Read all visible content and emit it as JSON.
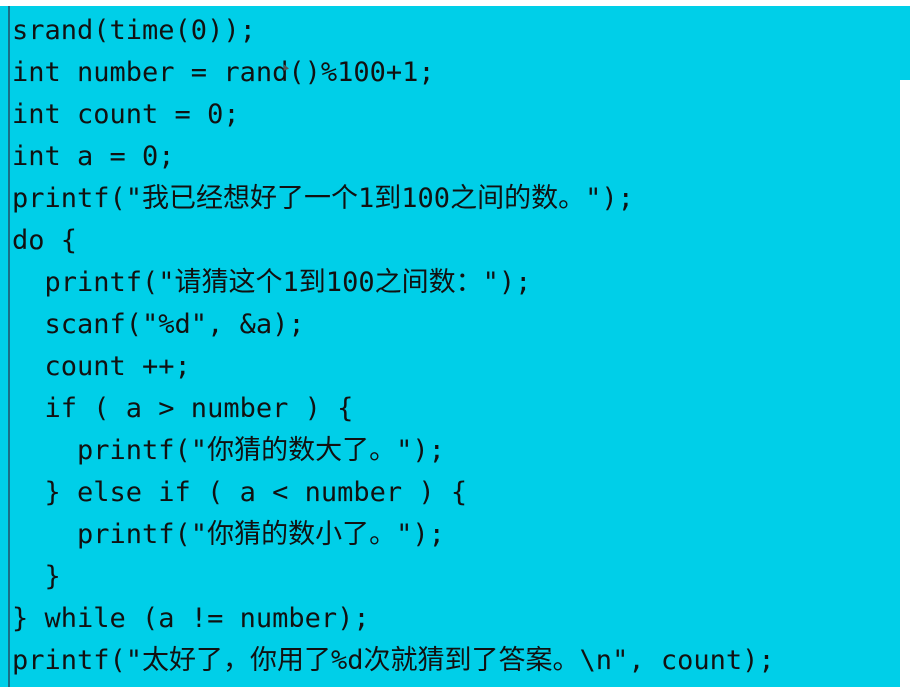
{
  "colors": {
    "panel_background": "#00cfe8",
    "text": "#111111"
  },
  "code": {
    "lines": [
      "srand(time(0));",
      "int number = rand()%100+1;",
      "int count = 0;",
      "int a = 0;",
      "printf(\"我已经想好了一个1到100之间的数。\");",
      "do {",
      "  printf(\"请猜这个1到100之间数：\");",
      "  scanf(\"%d\", &a);",
      "  count ++;",
      "  if ( a > number ) {",
      "    printf(\"你猜的数大了。\");",
      "  } else if ( a < number ) {",
      "    printf(\"你猜的数小了。\");",
      "  }",
      "} while (a != number);",
      "printf(\"太好了，你用了%d次就猜到了答案。\\n\", count);"
    ]
  }
}
